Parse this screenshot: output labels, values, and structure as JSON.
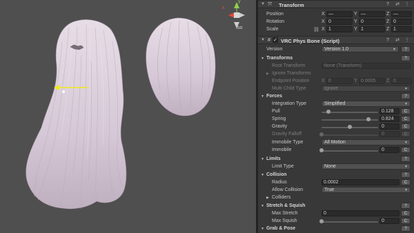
{
  "scene": {
    "gizmo": {
      "x_label": "x",
      "y_label": "y"
    },
    "projection_label": "Iso"
  },
  "transform": {
    "title": "Transform",
    "position": {
      "label": "Position",
      "x": "—",
      "y": "—",
      "z": "—"
    },
    "rotation": {
      "label": "Rotation",
      "x": "0",
      "y": "0",
      "z": "0"
    },
    "scale": {
      "label": "Scale",
      "x": "1",
      "y": "1",
      "z": "1"
    }
  },
  "vrc": {
    "title": "VRC Phys Bone (Script)",
    "version_label": "Version",
    "version_value": "Version 1.0",
    "transforms_section": "Transforms",
    "root_transform_label": "Root Transform",
    "root_transform_value": "None (Transform)",
    "ignore_transforms_label": "Ignore Transforms",
    "endpoint_label": "Endpoint Position",
    "endpoint": {
      "x": "0",
      "y": "0.0005",
      "z": "0"
    },
    "multi_child_label": "Multi Child Type",
    "multi_child_value": "Ignore",
    "forces_section": "Forces",
    "integration_label": "Integration Type",
    "integration_value": "Simplified",
    "pull_label": "Pull",
    "pull_value": "0.128",
    "spring_label": "Spring",
    "spring_value": "0.824",
    "gravity_label": "Gravity",
    "gravity_value": "0",
    "gravity_falloff_label": "Gravity Falloff",
    "gravity_falloff_value": "0",
    "immobile_type_label": "Immobile Type",
    "immobile_type_value": "All Motion",
    "immobile_label": "Immobile",
    "immobile_value": "0",
    "limits_section": "Limits",
    "limit_type_label": "Limit Type",
    "limit_type_value": "None",
    "collision_section": "Collision",
    "radius_label": "Radius",
    "radius_value": "0.0002",
    "allow_collision_label": "Allow Collision",
    "allow_collision_value": "True",
    "colliders_label": "Colliders",
    "stretch_section": "Stretch & Squish",
    "max_stretch_label": "Max Stretch",
    "max_stretch_value": "0",
    "max_squish_label": "Max Squish",
    "max_squish_value": "0",
    "grab_section": "Grab & Pose",
    "c_button": "C",
    "help_button": "?"
  },
  "sliders": {
    "pull": 0.128,
    "spring": 0.824,
    "gravity": 0.5,
    "gravity_falloff": 0,
    "immobile": 0,
    "max_squish": 0
  },
  "colors": {
    "scene_bg": "#4f4f4f",
    "hair": "#d9cdd9",
    "inspector_bg": "#383838",
    "gizmo_arrow": "#f2e81c"
  }
}
